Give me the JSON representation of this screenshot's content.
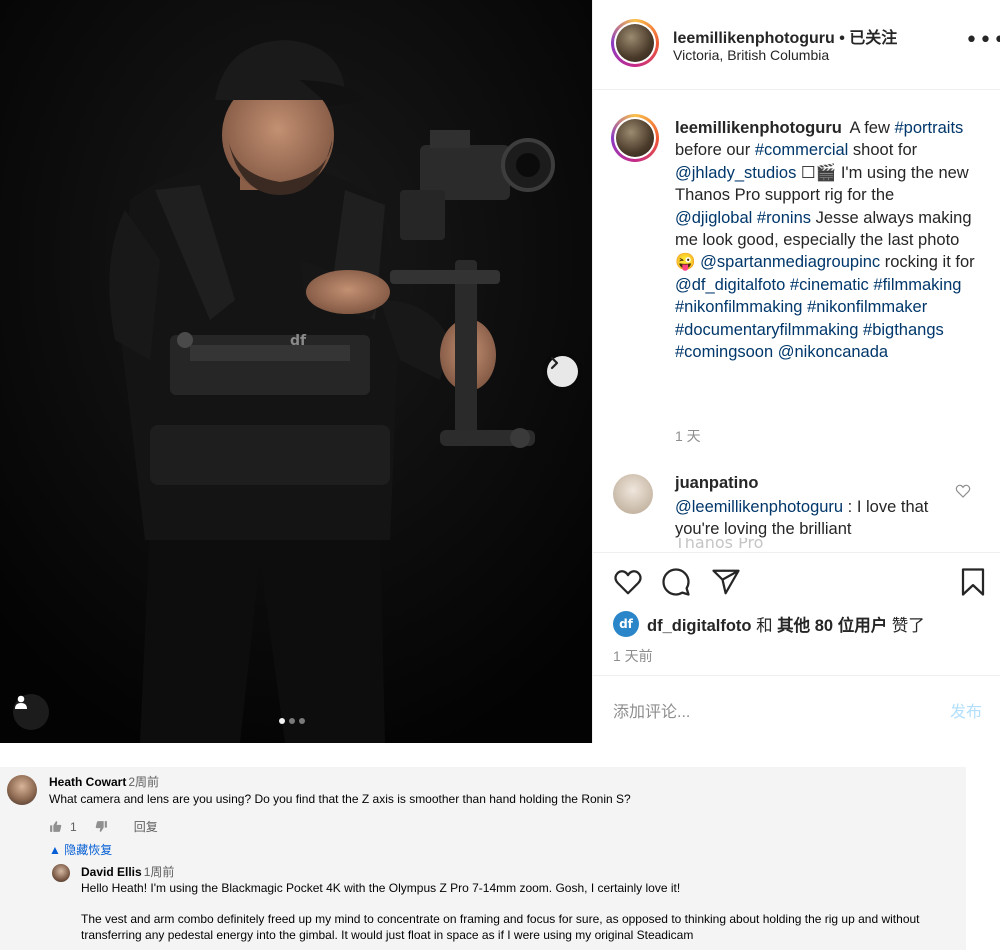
{
  "post": {
    "username": "leemillikenphotoguru",
    "follow_status": "• 已关注",
    "location": "Victoria, British Columbia",
    "more_label": "•••",
    "caption_user": "leemillikenphotoguru",
    "caption_segments": [
      {
        "t": "A few ",
        "link": false
      },
      {
        "t": "#portraits",
        "link": true
      },
      {
        "t": " before our ",
        "link": false
      },
      {
        "t": "#commercial",
        "link": true
      },
      {
        "t": " shoot for ",
        "link": false
      },
      {
        "t": "@jhlady_studios",
        "link": true
      },
      {
        "t": " ☐🎬 I'm using the new Thanos Pro support rig for the ",
        "link": false
      },
      {
        "t": "@djiglobal",
        "link": true
      },
      {
        "t": " ",
        "link": false
      },
      {
        "t": "#ronins",
        "link": true
      },
      {
        "t": " Jesse always making me look good, especially the last photo😜 ",
        "link": false
      },
      {
        "t": "@spartanmediagroupinc",
        "link": true
      },
      {
        "t": " rocking it for ",
        "link": false
      },
      {
        "t": "@df_digitalfoto",
        "link": true
      },
      {
        "t": " ",
        "link": false
      },
      {
        "t": "#cinematic",
        "link": true
      },
      {
        "t": " ",
        "link": false
      },
      {
        "t": "#filmmaking",
        "link": true
      },
      {
        "t": " ",
        "link": false
      },
      {
        "t": "#nikonfilmmaking",
        "link": true
      },
      {
        "t": " ",
        "link": false
      },
      {
        "t": "#nikonfilmmaker",
        "link": true
      },
      {
        "t": " ",
        "link": false
      },
      {
        "t": "#documentaryfilmmaking",
        "link": true
      },
      {
        "t": " ",
        "link": false
      },
      {
        "t": "#bigthangs",
        "link": true
      },
      {
        "t": " ",
        "link": false
      },
      {
        "t": "#comingsoon",
        "link": true
      },
      {
        "t": " ",
        "link": false
      },
      {
        "t": "@nikoncanada",
        "link": true
      }
    ],
    "caption_time": "1 天",
    "comment": {
      "user": "juanpatino",
      "mention": "@leemillikenphotoguru",
      "text": " : I love that you're loving the brilliant",
      "cut_text": "Thanos Pro"
    },
    "likes": {
      "badge": "df",
      "user": "df_digitalfoto",
      "and": "和",
      "others": "其他 80 位用户",
      "liked": "赞了"
    },
    "post_time": "1 天前",
    "add_comment_placeholder": "添加评论...",
    "publish_label": "发布",
    "icons": [
      "heart-icon",
      "comment-icon",
      "share-icon",
      "bookmark-icon",
      "chevron-right-icon",
      "user-tag-icon"
    ],
    "carousel": {
      "count": 3,
      "active": 1
    }
  },
  "youtube": {
    "comment1": {
      "author": "Heath Cowart",
      "time": "2周前",
      "text": "What camera and lens are you using? Do you find that the Z axis is smoother than hand holding the Ronin S?",
      "likes": "1",
      "reply_label": "回复",
      "hide_replies": "隐藏恢复"
    },
    "reply": {
      "author": "David Ellis",
      "time": "1周前",
      "text1": "Hello Heath! I'm using the Blackmagic Pocket 4K with the Olympus Z Pro 7-14mm zoom. Gosh, I certainly love it!",
      "text2": "The vest and arm combo definitely freed up my mind to concentrate on framing and focus for sure, as opposed to thinking about holding the rig up and without transferring any pedestal energy into the gimbal. It would just float in space as if I were using my original Steadicam"
    }
  },
  "colors": {
    "link": "#00376b",
    "muted": "#8e8e8e",
    "publish": "#b2dffc",
    "yt_link": "#065fd4",
    "df_badge": "#2a86c9"
  }
}
